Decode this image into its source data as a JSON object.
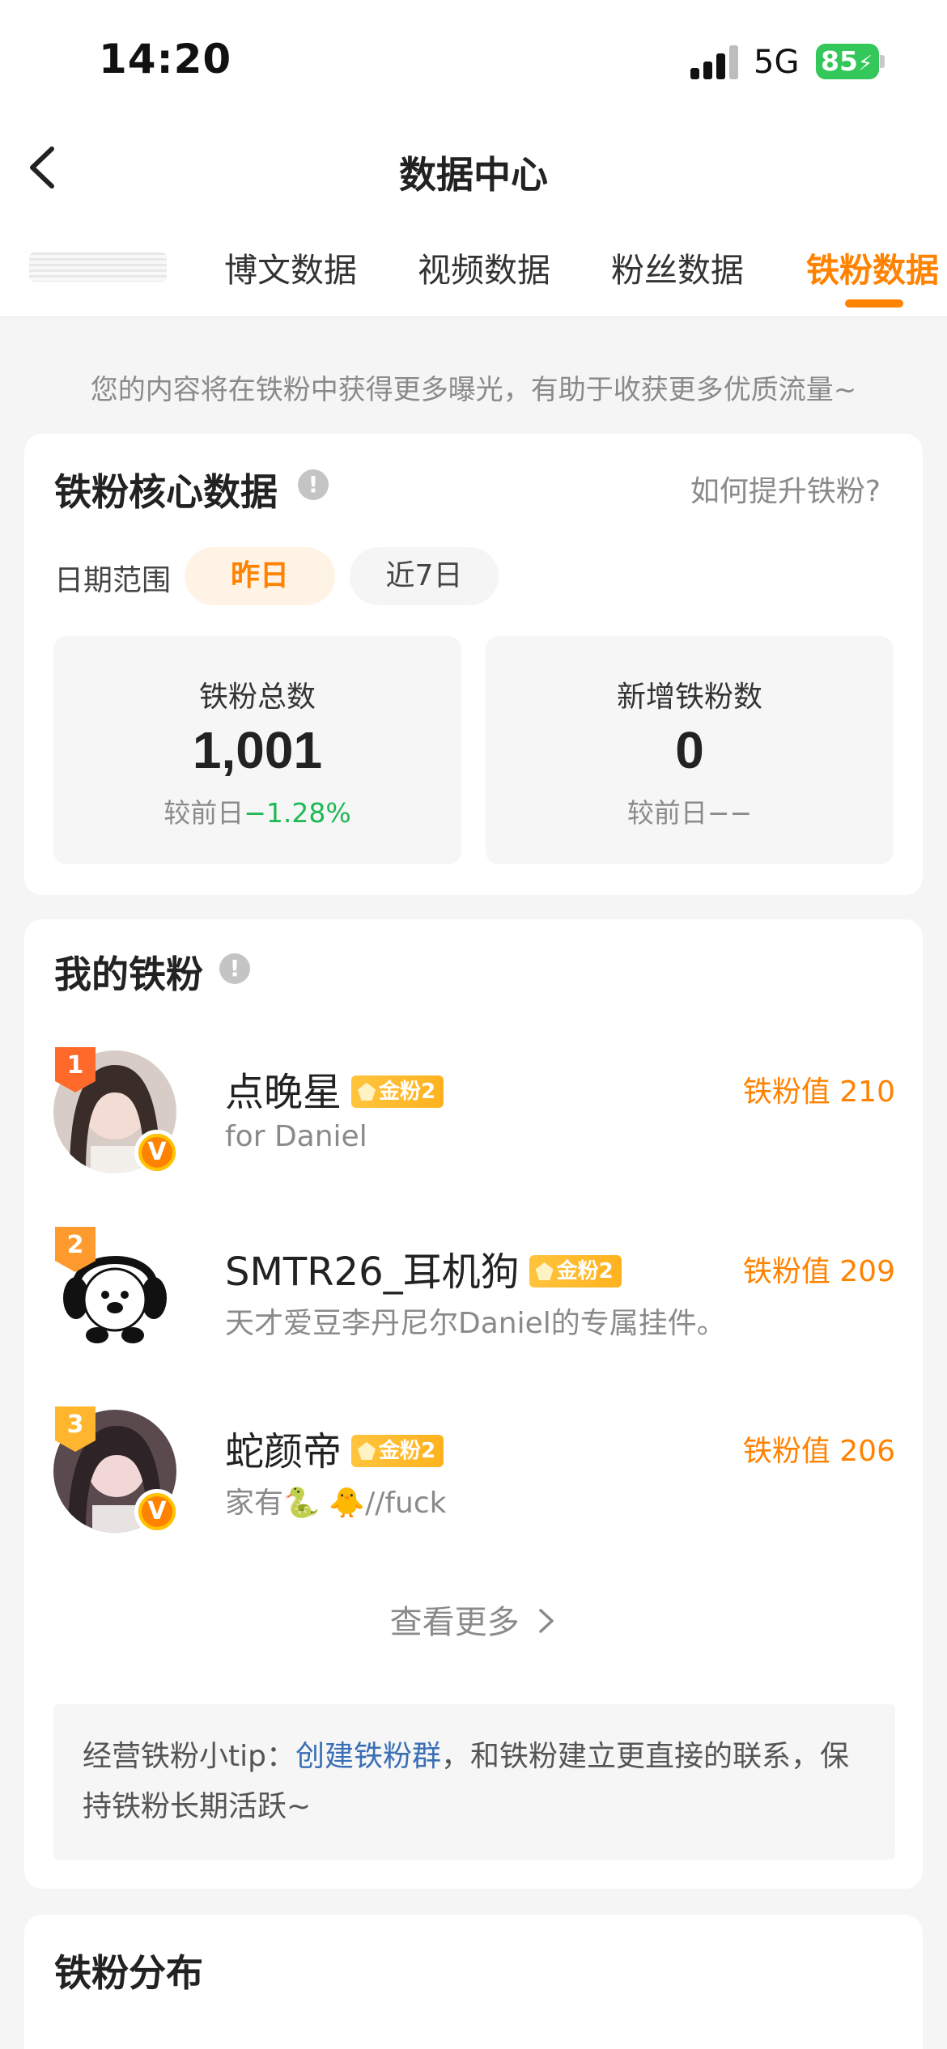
{
  "status_bar": {
    "time": "14:20",
    "network": "5G",
    "battery": "85"
  },
  "nav": {
    "title": "数据中心"
  },
  "tabs": [
    {
      "label": "博文数据"
    },
    {
      "label": "视频数据"
    },
    {
      "label": "粉丝数据"
    },
    {
      "label": "铁粉数据"
    }
  ],
  "active_tab_index": 3,
  "hint": "您的内容将在铁粉中获得更多曝光，有助于收获更多优质流量~",
  "core": {
    "title": "铁粉核心数据",
    "help_link": "如何提升铁粉?",
    "date_range_label": "日期范围",
    "date_options": [
      "昨日",
      "近7日"
    ],
    "selected_date_index": 0,
    "stats": [
      {
        "label": "铁粉总数",
        "value": "1,001",
        "compare_prefix": "较前日",
        "compare_value": "−1.28%"
      },
      {
        "label": "新增铁粉数",
        "value": "0",
        "compare_prefix": "较前日",
        "compare_value": "−−"
      }
    ]
  },
  "my_fans": {
    "title": "我的铁粉",
    "fans": [
      {
        "rank": "1",
        "name": "点晚星",
        "level": "金粉2",
        "desc": "for Daniel",
        "score": "铁粉值 210",
        "verified": true,
        "verified_label": "V",
        "rank_color": "#ff6a2b"
      },
      {
        "rank": "2",
        "name": "SMTR26_耳机狗",
        "level": "金粉2",
        "desc": "天才爱豆李丹尼尔Daniel的专属挂件。",
        "score": "铁粉值 209",
        "verified": false,
        "rank_color": "#ff9a2e"
      },
      {
        "rank": "3",
        "name": "蛇颜帝",
        "level": "金粉2",
        "desc": "家有🐍 🐥//fuck",
        "score": "铁粉值 206",
        "verified": true,
        "verified_label": "V",
        "rank_color": "#ffb52e"
      }
    ],
    "more_label": "查看更多",
    "tip_prefix": "经营铁粉小tip：",
    "tip_link": "创建铁粉群",
    "tip_suffix": "，和铁粉建立更直接的联系，保持铁粉长期活跃~"
  },
  "distribution": {
    "title": "铁粉分布"
  },
  "colors": {
    "accent": "#ff8200",
    "decrease": "#1db954",
    "link": "#3a6fb5"
  }
}
